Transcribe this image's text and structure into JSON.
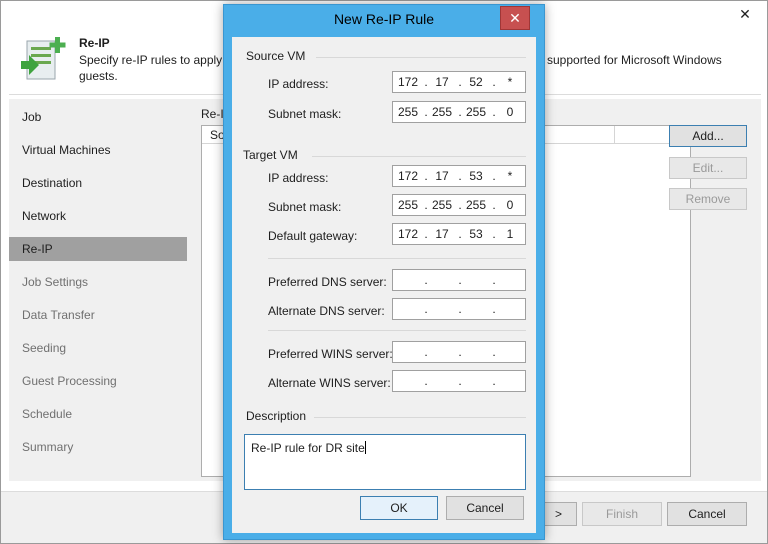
{
  "wizard": {
    "close_glyph": "✕",
    "header": {
      "title": "Re-IP",
      "desc_left": "Specify re-IP rules to apply t",
      "desc_right": "supported for Microsoft Windows",
      "desc_line2": "guests."
    },
    "nav": [
      {
        "label": "Job",
        "state": "normal"
      },
      {
        "label": "Virtual Machines",
        "state": "normal"
      },
      {
        "label": "Destination",
        "state": "normal"
      },
      {
        "label": "Network",
        "state": "normal"
      },
      {
        "label": "Re-IP",
        "state": "active"
      },
      {
        "label": "Job Settings",
        "state": "disabled"
      },
      {
        "label": "Data Transfer",
        "state": "disabled"
      },
      {
        "label": "Seeding",
        "state": "disabled"
      },
      {
        "label": "Guest Processing",
        "state": "disabled"
      },
      {
        "label": "Schedule",
        "state": "disabled"
      },
      {
        "label": "Summary",
        "state": "disabled"
      }
    ],
    "content": {
      "list_label": "Re-I",
      "column_header": "So"
    },
    "buttons": {
      "add": "Add...",
      "edit": "Edit...",
      "remove": "Remove"
    },
    "footer": {
      "next": ">",
      "finish": "Finish",
      "cancel": "Cancel"
    }
  },
  "dialog": {
    "title": "New Re-IP Rule",
    "close_glyph": "✕",
    "source_vm": {
      "title": "Source VM",
      "ip_label": "IP address:",
      "ip": [
        "172",
        "17",
        "52",
        "*"
      ],
      "mask_label": "Subnet mask:",
      "mask": [
        "255",
        "255",
        "255",
        "0"
      ]
    },
    "target_vm": {
      "title": "Target VM",
      "ip_label": "IP address:",
      "ip": [
        "172",
        "17",
        "53",
        "*"
      ],
      "mask_label": "Subnet mask:",
      "mask": [
        "255",
        "255",
        "255",
        "0"
      ],
      "gateway_label": "Default gateway:",
      "gateway": [
        "172",
        "17",
        "53",
        "1"
      ],
      "pref_dns_label": "Preferred DNS server:",
      "alt_dns_label": "Alternate DNS server:",
      "pref_wins_label": "Preferred WINS server:",
      "alt_wins_label": "Alternate WINS server:"
    },
    "description": {
      "title": "Description",
      "value": "Re-IP rule for DR site"
    },
    "dot": ".",
    "ok": "OK",
    "cancel": "Cancel"
  },
  "colors": {
    "dialog_frame": "#4aaee8",
    "close_button": "#c75050",
    "accent_border": "#3c7fb1",
    "active_nav": "#a0a0a0"
  }
}
